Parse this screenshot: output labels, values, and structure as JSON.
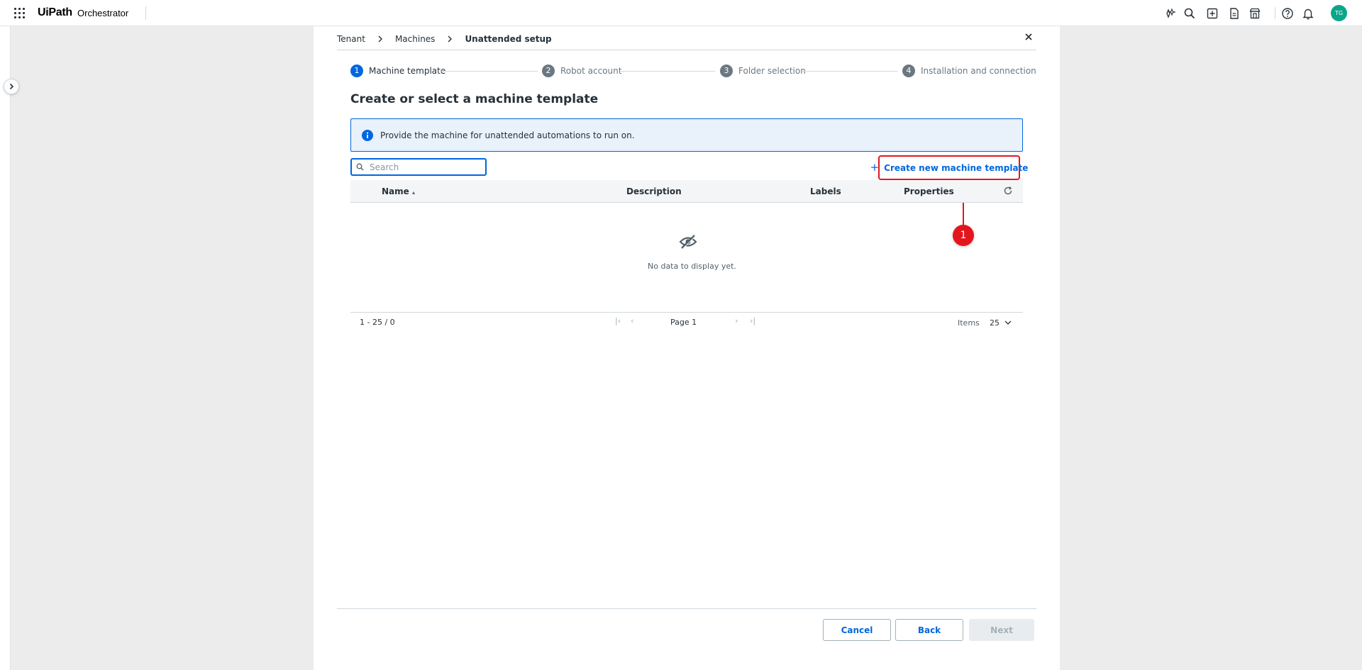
{
  "header": {
    "logo_text": "UiPath",
    "product_name": "Orchestrator",
    "user_initials": "TG",
    "icons": [
      "autopilot-icon",
      "search-icon",
      "add-icon",
      "document-icon",
      "store-icon",
      "help-icon",
      "notifications-icon"
    ]
  },
  "breadcrumb": [
    "Tenant",
    "Machines",
    "Unattended setup"
  ],
  "stepper": [
    {
      "num": "1",
      "label": "Machine template"
    },
    {
      "num": "2",
      "label": "Robot account"
    },
    {
      "num": "3",
      "label": "Folder selection"
    },
    {
      "num": "4",
      "label": "Installation and connection"
    }
  ],
  "page_title": "Create or select a machine template",
  "info_message": "Provide the machine for unattended automations to run on.",
  "search": {
    "placeholder": "Search"
  },
  "create_button_label": "Create new machine template",
  "callout_number": "1",
  "table": {
    "columns": [
      "Name",
      "Description",
      "Labels",
      "Properties"
    ],
    "sort_indicator": "▴",
    "empty_message": "No data to display yet.",
    "range_text": "1 - 25 / 0",
    "page_text": "Page 1",
    "items_label": "Items",
    "items_per_page": "25"
  },
  "footer_buttons": {
    "cancel": "Cancel",
    "back": "Back",
    "next": "Next"
  },
  "colors": {
    "primary": "#0067df",
    "callout": "#e3161e",
    "avatar": "#0ba58a"
  }
}
